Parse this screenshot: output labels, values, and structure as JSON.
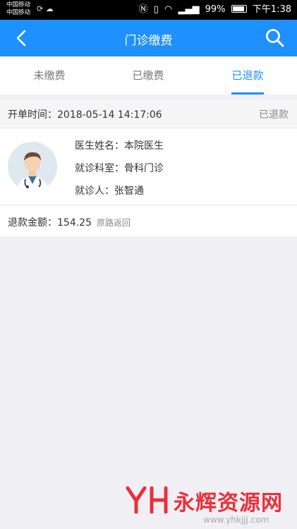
{
  "status_bar": {
    "carrier_1": "中国移动",
    "carrier_2": "中国移动",
    "battery": "99%",
    "time": "下午1:38",
    "icons": [
      "nfc-icon",
      "vibrate-icon",
      "wifi-icon",
      "signal-icon",
      "battery-icon"
    ]
  },
  "nav": {
    "title": "门诊缴费",
    "back_icon": "chevron-left-icon",
    "search_icon": "search-icon",
    "color": "#1e90ff"
  },
  "tabs": [
    {
      "label": "未缴费",
      "active": false
    },
    {
      "label": "已缴费",
      "active": false
    },
    {
      "label": "已退款",
      "active": true
    }
  ],
  "record": {
    "time_label": "开单时间：2018-05-14 14:17:06",
    "status": "已退款",
    "doctor": "医生姓名：本院医生",
    "department": "就诊科室：骨科门诊",
    "patient": "就诊人：张智通",
    "refund_label": "退款金额：",
    "refund_amount": "154.25",
    "refund_note": "原路返回"
  },
  "watermark": {
    "text": "永辉资源网",
    "url": "www.yhkjjj.com"
  }
}
